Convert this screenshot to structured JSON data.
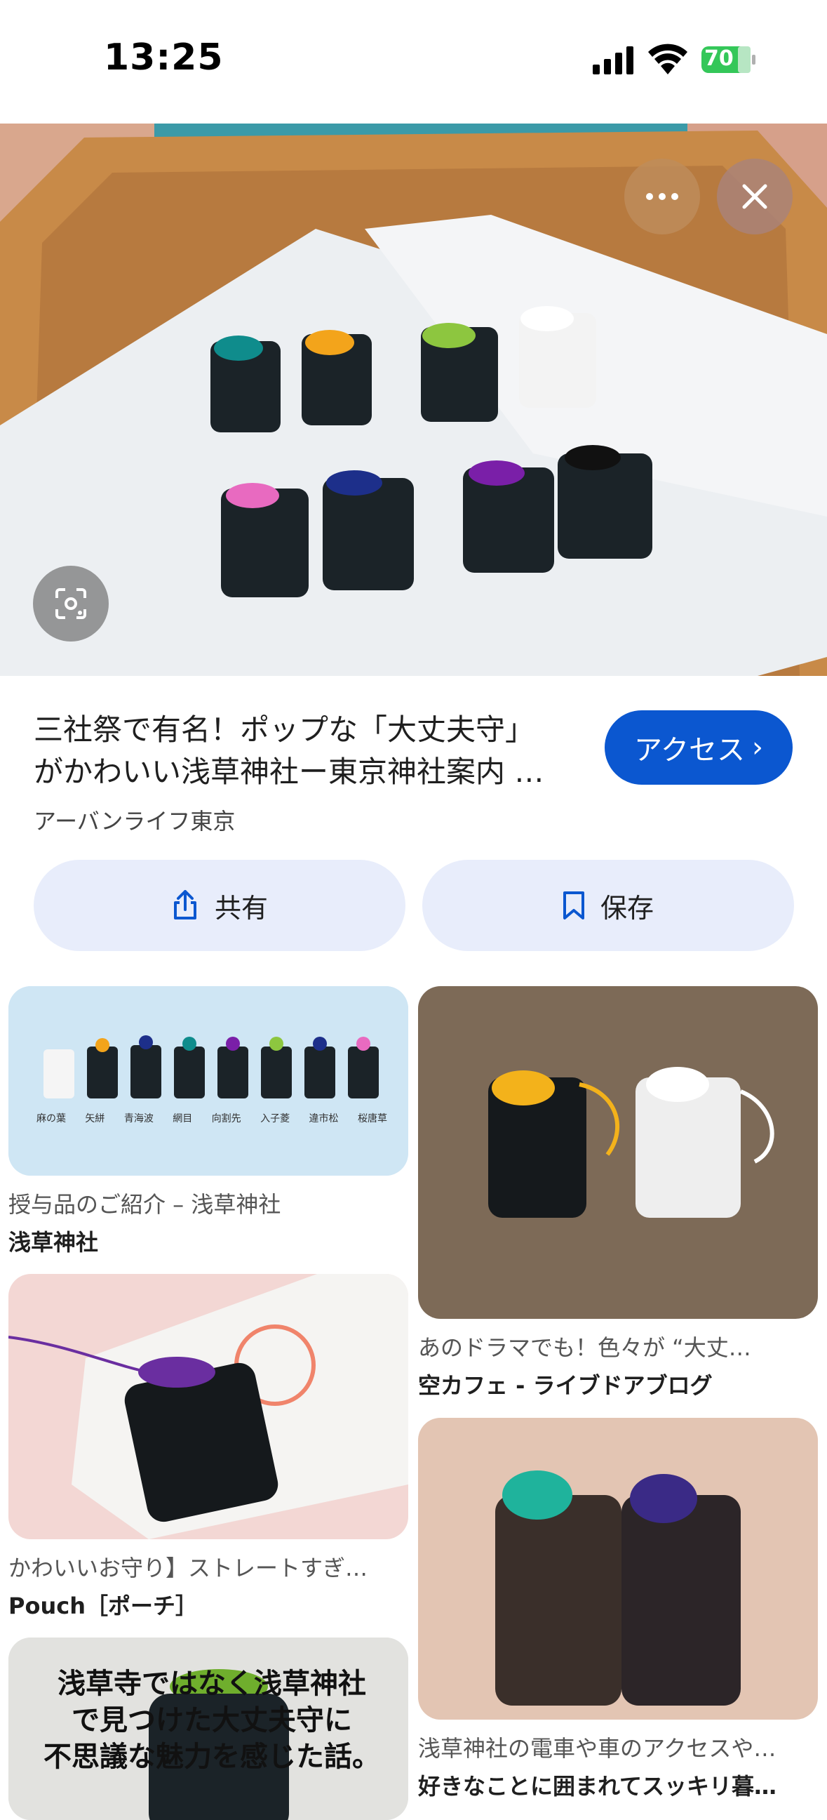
{
  "status_bar": {
    "time": "13:25",
    "battery": "70"
  },
  "result": {
    "title_line1": "三社祭で有名！ポップな「大丈夫守」",
    "title_line2": "がかわいい浅草神社ー東京神社案内 …",
    "source": "アーバンライフ東京",
    "access_label": "アクセス",
    "share_label": "共有",
    "save_label": "保存"
  },
  "related": [
    {
      "caption": "授与品のご紹介 – 浅草神社",
      "source": "浅草神社",
      "image_labels": [
        "麻の葉",
        "矢絣",
        "青海波",
        "網目",
        "向割先",
        "入子菱",
        "違市松",
        "桜唐草"
      ]
    },
    {
      "caption": "あのドラマでも！色々が “大丈…",
      "source": "空カフェ - ライブドアブログ"
    },
    {
      "caption": "かわいいお守り】ストレートすぎ…",
      "source": "Pouch［ポーチ］"
    },
    {
      "caption": "浅草神社の電車や車のアクセスや…",
      "source": "好きなことに囲まれてスッキリ暮…"
    },
    {
      "image_text_line1": "浅草寺ではなく浅草神社",
      "image_text_line2": "で見つけた大丈夫守に",
      "image_text_line3": "不思議な魅力を感じた話。"
    }
  ],
  "colors": {
    "accent": "#0b57d0",
    "pill_bg": "#e8edfb"
  },
  "icons": {
    "more": "more-horizontal-icon",
    "close": "close-icon",
    "lens": "lens-icon",
    "share": "share-icon",
    "save": "bookmark-icon"
  }
}
